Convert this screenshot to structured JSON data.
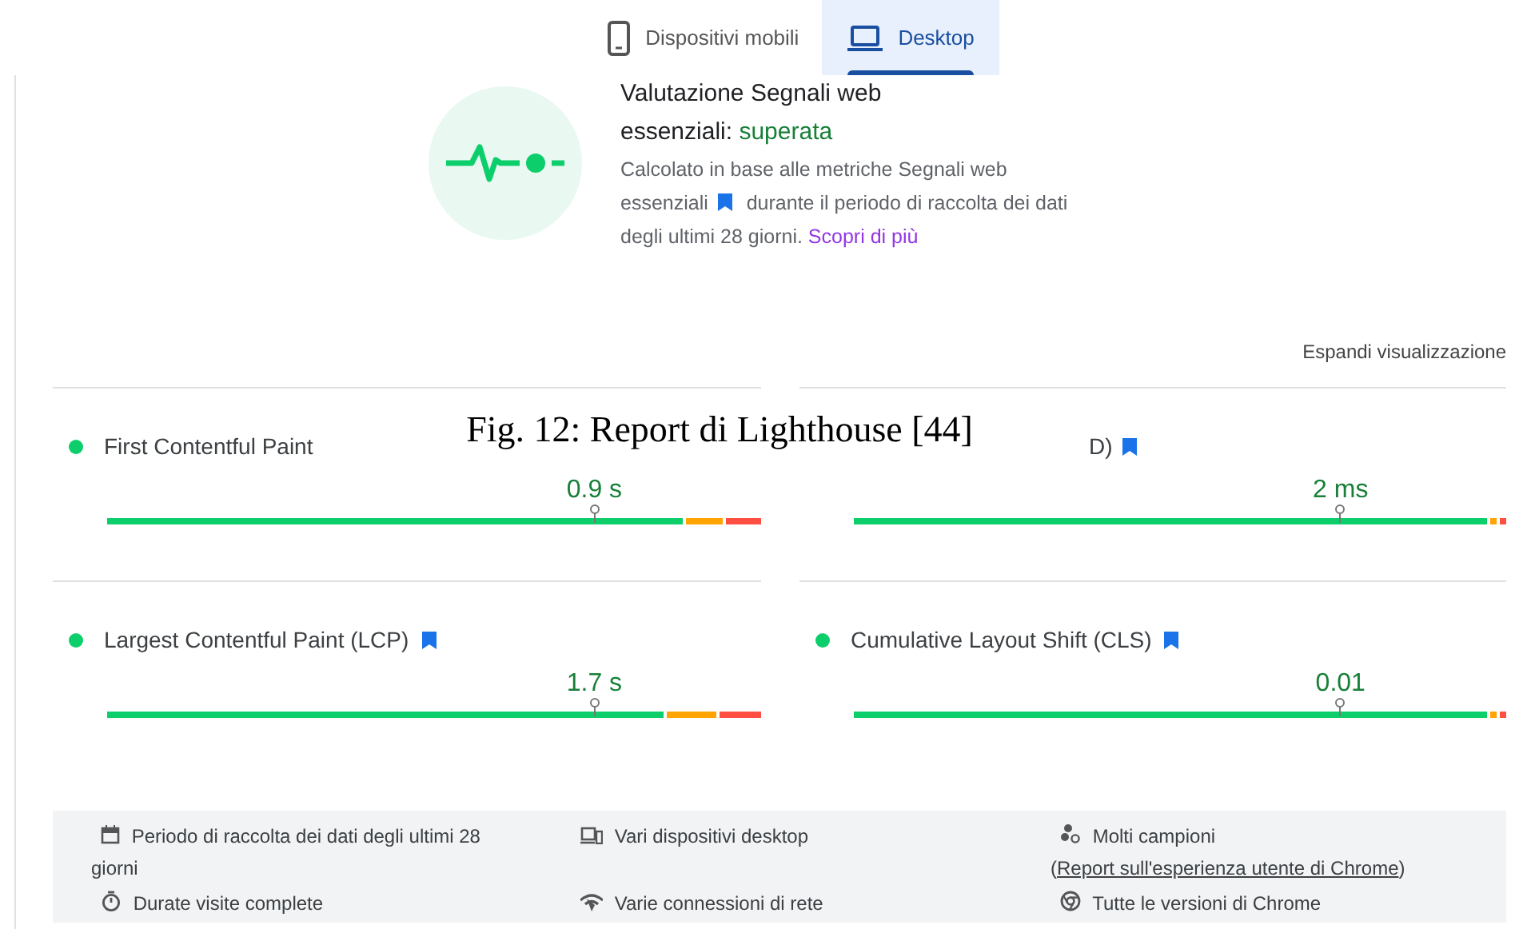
{
  "tabs": [
    {
      "label": "Dispositivi mobili",
      "selected": false
    },
    {
      "label": "Desktop",
      "selected": true
    }
  ],
  "assessment": {
    "title": "Valutazione Segnali web",
    "title_line2": "essenziali:",
    "result": "superata",
    "passed": true,
    "description_before": "Calcolato in base alle metriche Segnali web essenziali",
    "description_after": "durante il periodo di raccolta dei dati degli ultimi 28 giorni.",
    "link": "Scopri di più"
  },
  "expand_link": "Espandi visualizzazione",
  "metrics": [
    {
      "title": "First Contentful Paint",
      "core": false,
      "value": "0.9 s",
      "color": "#0cce6b",
      "level": 0.745
    },
    {
      "title": "D)",
      "core": true,
      "value": "2 ms",
      "level": 0.746
    },
    {
      "title": "Largest Contentful Paint (LCP)",
      "core": true,
      "value": "1.7 s",
      "color": "#0cce6b",
      "level": 0.745
    },
    {
      "title": "Cumulative Layout Shift (CLS)",
      "core": true,
      "value": "0.01",
      "color": "#0cce6b",
      "level": 0.746
    }
  ],
  "footer_items": [
    {
      "text": "Periodo di raccolta dei dati degli ultimi 28 giorni"
    },
    {
      "text": "Vari dispositivi desktop"
    },
    {
      "text": "Molti campioni (",
      "link": "Report sull'esperienza utente di Chrome",
      "text_after": ")"
    },
    {
      "text": "Durate visite complete"
    },
    {
      "text": "Varie connessioni di rete"
    },
    {
      "text": "Tutte le versioni di Chrome"
    }
  ],
  "caption": "Fig. 12: Report di Lighthouse [44]"
}
